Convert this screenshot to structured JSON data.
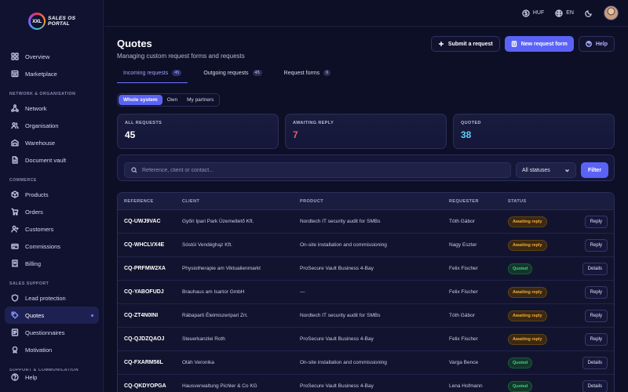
{
  "logo": {
    "mark": "XXL",
    "line1": "SALES OS",
    "line2": "PORTAL"
  },
  "sidebar": {
    "items": [
      {
        "type": "item",
        "label": "Overview",
        "icon": "grid-icon"
      },
      {
        "type": "item",
        "label": "Marketplace",
        "icon": "store-icon"
      },
      {
        "type": "section",
        "label": "NETWORK & ORGANISATION"
      },
      {
        "type": "item",
        "label": "Network",
        "icon": "network-icon"
      },
      {
        "type": "item",
        "label": "Organisation",
        "icon": "users-icon"
      },
      {
        "type": "item",
        "label": "Warehouse",
        "icon": "warehouse-icon"
      },
      {
        "type": "item",
        "label": "Document vault",
        "icon": "document-icon"
      },
      {
        "type": "section",
        "label": "COMMERCE"
      },
      {
        "type": "item",
        "label": "Products",
        "icon": "box-icon"
      },
      {
        "type": "item",
        "label": "Orders",
        "icon": "cart-icon"
      },
      {
        "type": "item",
        "label": "Customers",
        "icon": "customers-icon"
      },
      {
        "type": "item",
        "label": "Commissions",
        "icon": "commission-icon"
      },
      {
        "type": "item",
        "label": "Billing",
        "icon": "billing-icon"
      },
      {
        "type": "section",
        "label": "SALES SUPPORT"
      },
      {
        "type": "item",
        "label": "Lead protection",
        "icon": "shield-icon"
      },
      {
        "type": "item",
        "label": "Quotes",
        "icon": "tag-icon",
        "active": true
      },
      {
        "type": "item",
        "label": "Questionnaires",
        "icon": "questionnaire-icon"
      },
      {
        "type": "item",
        "label": "Motivation",
        "icon": "motivation-icon"
      },
      {
        "type": "section",
        "label": "SUPPORT & COMMUNICATION"
      }
    ],
    "help": "Help"
  },
  "topbar": {
    "currency": "HUF",
    "language": "EN"
  },
  "page": {
    "title": "Quotes",
    "subtitle": "Managing custom request forms and requests",
    "submit_label": "Submit a request",
    "new_form_label": "New request form",
    "help_label": "Help"
  },
  "tabs": [
    {
      "label": "Incoming requests",
      "count": "45",
      "active": true
    },
    {
      "label": "Outgoing requests",
      "count": "45"
    },
    {
      "label": "Request forms",
      "count": "6"
    }
  ],
  "scope": [
    "Whole system",
    "Own",
    "My partners"
  ],
  "stats": [
    {
      "label": "ALL REQUESTS",
      "value": "45",
      "color": "#ffffff"
    },
    {
      "label": "AWAITING REPLY",
      "value": "7",
      "color": "#f0566a"
    },
    {
      "label": "QUOTED",
      "value": "38",
      "color": "#5fd1f5"
    }
  ],
  "filter": {
    "placeholder": "Reference, client or contact...",
    "status": "All statuses",
    "button": "Filter"
  },
  "table": {
    "headers": [
      "REFERENCE",
      "CLIENT",
      "PRODUCT",
      "REQUESTER",
      "STATUS"
    ],
    "rows": [
      {
        "ref": "CQ-UWJ9VAC",
        "client": "Győri Ipari Park Üzemeltető Kft.",
        "product": "Nordtech IT security audit for SMBs",
        "requester": "Tóth Gábor",
        "status": "Awaiting reply",
        "kind": "await",
        "action": "Reply"
      },
      {
        "ref": "CQ-WHCLVX4E",
        "client": "Sóstói Vendéghąz Kft.",
        "product": "On-site installation and commissioning",
        "requester": "Nagy Eszter",
        "status": "Awaiting reply",
        "kind": "await",
        "action": "Reply"
      },
      {
        "ref": "CQ-PRFMW2XA",
        "client": "Physiotherapie am Viktualienmarkt",
        "product": "ProSecure Vault Business 4-Bay",
        "requester": "Felix Fischer",
        "status": "Quoted",
        "kind": "quoted",
        "action": "Details"
      },
      {
        "ref": "CQ-YABOFUDJ",
        "client": "Brauhaus am Isartor GmbH",
        "product": "—",
        "requester": "Felix Fischer",
        "status": "Awaiting reply",
        "kind": "await",
        "action": "Reply"
      },
      {
        "ref": "CQ-ZT4N0INI",
        "client": "Rábaparti Élelmiszeripari Zrt.",
        "product": "Nordtech IT security audit for SMBs",
        "requester": "Tóth Gábor",
        "status": "Awaiting reply",
        "kind": "await",
        "action": "Reply"
      },
      {
        "ref": "CQ-QJDZQAOJ",
        "client": "Steuerkanzlei Roth",
        "product": "ProSecure Vault Business 4-Bay",
        "requester": "Felix Fischer",
        "status": "Awaiting reply",
        "kind": "await",
        "action": "Reply"
      },
      {
        "ref": "CQ-FXARM56L",
        "client": "Oláh Veronika",
        "product": "On-site installation and commissioning",
        "requester": "Varga Bence",
        "status": "Quoted",
        "kind": "quoted",
        "action": "Details"
      },
      {
        "ref": "CQ-QKDYOPGA",
        "client": "Hausverwaltung Pichler & Co KG",
        "product": "ProSecure Vault Business 4-Bay",
        "requester": "Lena Hofmann",
        "status": "Quoted",
        "kind": "quoted",
        "action": "Details"
      }
    ]
  }
}
